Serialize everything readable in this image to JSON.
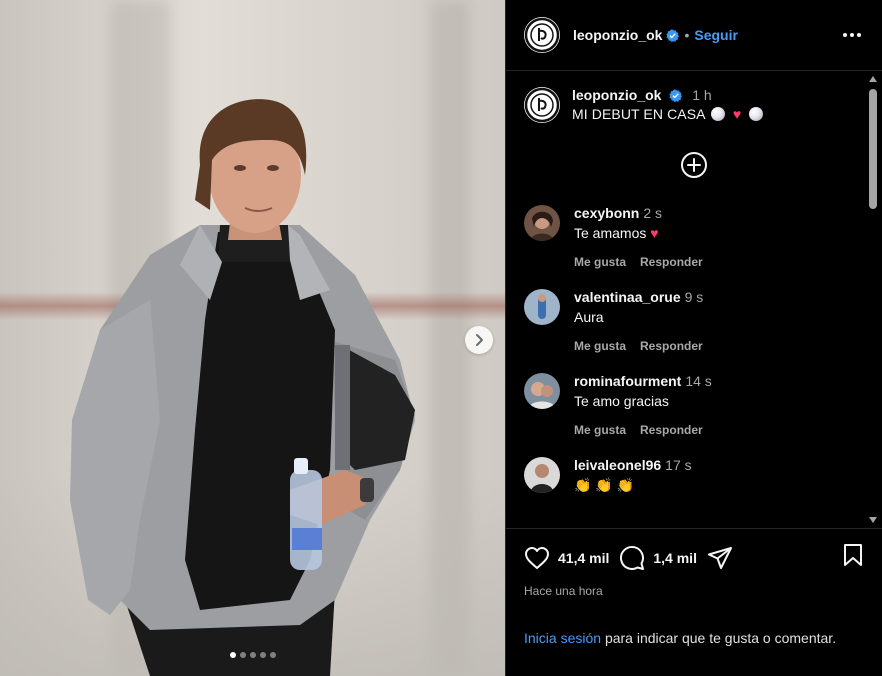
{
  "post": {
    "username": "leoponzio_ok",
    "follow_label": "Seguir",
    "separator": "•",
    "caption_time": "1 h",
    "caption_text": "MI DEBUT EN CASA",
    "carousel_count": 5,
    "carousel_active_index": 0
  },
  "comments": [
    {
      "username": "cexybonn",
      "time": "2 s",
      "text": "Te amamos",
      "like_label": "Me gusta",
      "reply_label": "Responder"
    },
    {
      "username": "valentinaa_orue",
      "time": "9 s",
      "text": "Aura",
      "like_label": "Me gusta",
      "reply_label": "Responder"
    },
    {
      "username": "rominafourment",
      "time": "14 s",
      "text": "Te amo gracias",
      "like_label": "Me gusta",
      "reply_label": "Responder"
    },
    {
      "username": "leivaleonel96",
      "time": "17 s",
      "text": "👏 👏 👏",
      "like_label": "",
      "reply_label": ""
    }
  ],
  "footer": {
    "likes": "41,4 mil",
    "comments": "1,4 mil",
    "posted": "Hace una hora",
    "login_link": "Inicia sesión",
    "login_text": "para indicar que te gusta o comentar."
  },
  "icons": {
    "more": "more-horizontal-icon",
    "heart": "heart-icon",
    "comment": "comment-icon",
    "share": "share-icon",
    "save": "bookmark-icon",
    "add": "plus-circle-icon",
    "next": "chevron-right-icon"
  },
  "colors": {
    "link": "#4a9bf5",
    "verified": "#3897f0",
    "heart": "#ff3b6b",
    "background": "#000000",
    "muted": "#a8a8a8"
  }
}
